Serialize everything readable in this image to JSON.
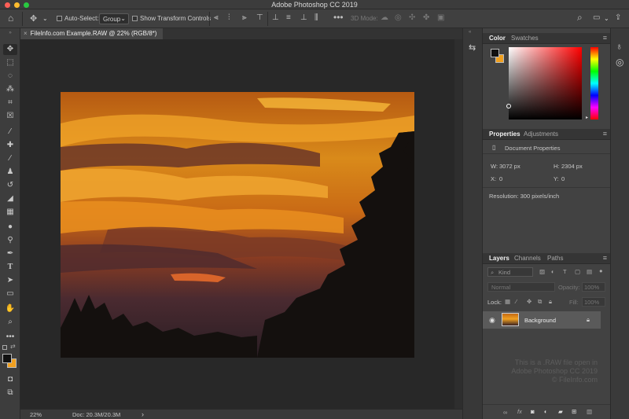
{
  "app": {
    "title": "Adobe Photoshop CC 2019"
  },
  "options_bar": {
    "auto_select_label": "Auto-Select:",
    "auto_select_value": "Group",
    "show_transform_label": "Show Transform Controls",
    "mode_3d_label": "3D Mode:"
  },
  "document": {
    "tab_label": "FileInfo.com Example.RAW @ 22% (RGB/8*)",
    "close_glyph": "×"
  },
  "status": {
    "zoom": "22%",
    "doc_size": "Doc: 20.3M/20.3M",
    "arrow": "›"
  },
  "color_panel": {
    "tabs": [
      "Color",
      "Swatches"
    ],
    "foreground": "#111111",
    "background": "#f0a020"
  },
  "properties_panel": {
    "tabs": [
      "Properties",
      "Adjustments"
    ],
    "title": "Document Properties",
    "w_label": "W:",
    "w_value": "3072 px",
    "h_label": "H:",
    "h_value": "2304 px",
    "x_label": "X:",
    "x_value": "0",
    "y_label": "Y:",
    "y_value": "0",
    "resolution": "Resolution: 300 pixels/inch"
  },
  "layers_panel": {
    "tabs": [
      "Layers",
      "Channels",
      "Paths"
    ],
    "filter_label": "Kind",
    "blend_mode": "Normal",
    "opacity_label": "Opacity:",
    "opacity_value": "100%",
    "lock_label": "Lock:",
    "fill_label": "Fill:",
    "fill_value": "100%",
    "layers": [
      {
        "name": "Background",
        "visible": true,
        "locked": true
      }
    ],
    "footer_icons": [
      "link-icon",
      "fx-icon",
      "mask-icon",
      "adjustment-icon",
      "group-icon",
      "new-layer-icon",
      "trash-icon"
    ]
  },
  "watermark": {
    "line1": "This is a .RAW file open in",
    "line2": "Adobe Photoshop CC 2019",
    "line3": "© FileInfo.com"
  },
  "tools": [
    "move-icon",
    "marquee-icon",
    "lasso-icon",
    "magic-wand-icon",
    "crop-icon",
    "frame-icon",
    "eyedropper-icon",
    "healing-icon",
    "brush-icon",
    "stamp-icon",
    "history-brush-icon",
    "eraser-icon",
    "gradient-icon",
    "blur-icon",
    "dodge-icon",
    "pen-icon",
    "type-icon",
    "path-select-icon",
    "rectangle-icon",
    "hand-icon",
    "zoom-icon",
    "more-icon"
  ],
  "colors": {
    "accent_swatch_fg": "#111111",
    "accent_swatch_bg": "#f0a020"
  }
}
